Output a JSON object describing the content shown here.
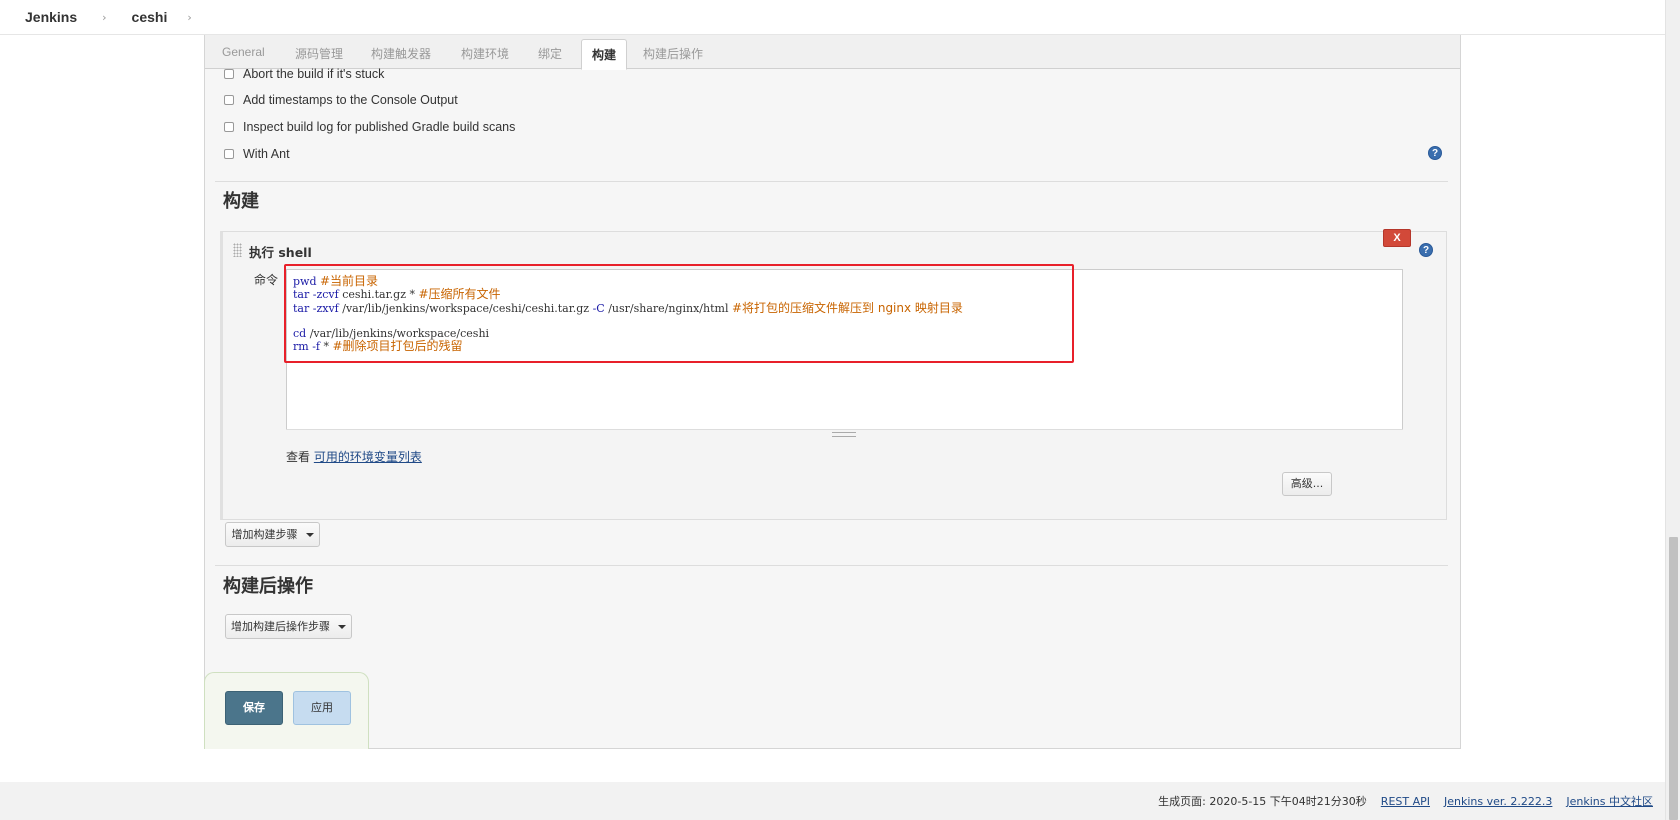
{
  "breadcrumb": {
    "items": [
      "Jenkins",
      "ceshi"
    ]
  },
  "tabs": [
    "General",
    "源码管理",
    "构建触发器",
    "构建环境",
    "绑定",
    "构建",
    "构建后操作"
  ],
  "build_env": {
    "options": [
      {
        "label": "Abort the build if it's stuck",
        "checked": false
      },
      {
        "label": "Add timestamps to the Console Output",
        "checked": false
      },
      {
        "label": "Inspect build log for published Gradle build scans",
        "checked": false
      },
      {
        "label": "With Ant",
        "checked": false
      }
    ]
  },
  "help_glyph": "?",
  "build": {
    "title": "构建",
    "step": {
      "title": "执行 shell",
      "delete_label": "X",
      "command_label": "命令",
      "command_lines": [
        {
          "cmd": "pwd",
          "flag": "",
          "rest": " ",
          "comment": "#当前目录"
        },
        {
          "cmd": "tar",
          "flag": " -zcvf",
          "rest": " ceshi.tar.gz * ",
          "comment": "#压缩所有文件"
        },
        {
          "cmd": "tar",
          "flag": " -zxvf",
          "rest": " /var/lib/jenkins/workspace/ceshi/ceshi.tar.gz ",
          "flag2": "-C",
          "rest2": " /usr/share/nginx/html ",
          "comment": "#将打包的压缩文件解压到 nginx 映射目录"
        },
        {
          "blank": true
        },
        {
          "cmd": "cd",
          "flag": "",
          "rest": " /var/lib/jenkins/workspace/ceshi",
          "comment": ""
        },
        {
          "cmd": "rm",
          "flag": " -f",
          "rest": " * ",
          "comment": "#删除项目打包后的残留"
        }
      ],
      "env_prefix": "查看",
      "env_link": "可用的环境变量列表",
      "advanced_label": "高级..."
    },
    "add_step_label": "增加构建步骤"
  },
  "post_build": {
    "title": "构建后操作",
    "add_step_label": "增加构建后操作步骤"
  },
  "actions": {
    "save_label": "保存",
    "apply_label": "应用"
  },
  "footer": {
    "generated": "生成页面: 2020-5-15 下午04时21分30秒",
    "links": [
      "REST API",
      "Jenkins ver. 2.222.3",
      "Jenkins 中文社区"
    ]
  },
  "colors": {
    "save": "#4b758b",
    "apply": "#c6dcf0",
    "delete": "#d24939",
    "highlight": "#e8202a",
    "link": "#204a87"
  }
}
